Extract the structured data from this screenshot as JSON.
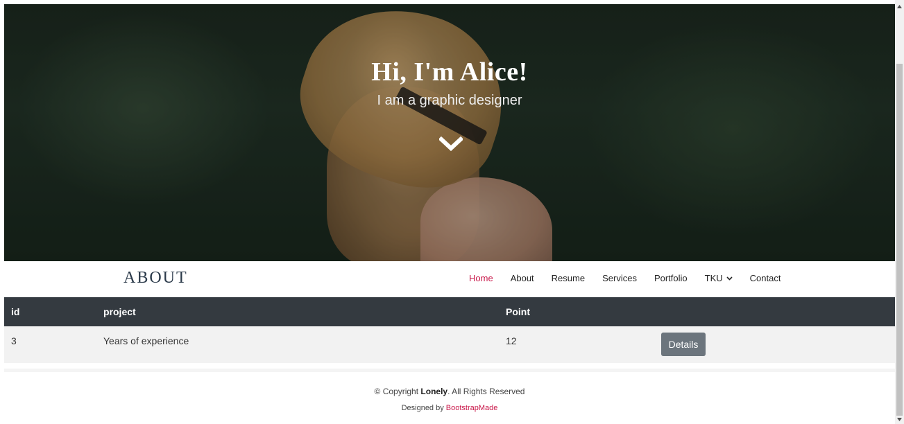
{
  "hero": {
    "title": "Hi, I'm Alice!",
    "subtitle": "I am a graphic designer",
    "arrow_icon": "chevron-down-icon"
  },
  "navbar": {
    "brand": "ABOUT",
    "items": [
      {
        "label": "Home",
        "active": true
      },
      {
        "label": "About",
        "active": false
      },
      {
        "label": "Resume",
        "active": false
      },
      {
        "label": "Services",
        "active": false
      },
      {
        "label": "Portfolio",
        "active": false
      },
      {
        "label": "TKU",
        "active": false,
        "dropdown": true
      },
      {
        "label": "Contact",
        "active": false
      }
    ],
    "active_color": "#c9184a"
  },
  "table": {
    "headers": {
      "id": "id",
      "project": "project",
      "point": "Point"
    },
    "rows": [
      {
        "id": "3",
        "project": "Years of experience",
        "point": "12",
        "action": "Details"
      }
    ],
    "header_bg": "#343a40",
    "button_bg": "#6c757d"
  },
  "footer": {
    "copyright_prefix": "© Copyright ",
    "brand": "Lonely",
    "copyright_suffix": ". All Rights Reserved",
    "designed_prefix": "Designed by ",
    "designed_link": "BootstrapMade",
    "link_color": "#c9184a"
  }
}
